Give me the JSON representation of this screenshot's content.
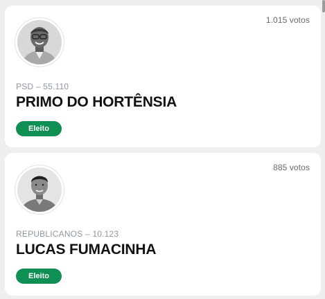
{
  "candidates": [
    {
      "votes": "1.015 votos",
      "party_number": "PSD – 55.110",
      "name": "PRIMO DO HORTÊNSIA",
      "status": "Eleito",
      "photo": "candidate-photo-icon"
    },
    {
      "votes": "885 votos",
      "party_number": "REPUBLICANOS – 10.123",
      "name": "LUCAS FUMACINHA",
      "status": "Eleito",
      "photo": "candidate-photo-icon"
    }
  ],
  "colors": {
    "elected_badge": "#0f8f53",
    "card_background": "#ffffff",
    "page_background": "#efefef",
    "party_text": "#8d96a3"
  }
}
